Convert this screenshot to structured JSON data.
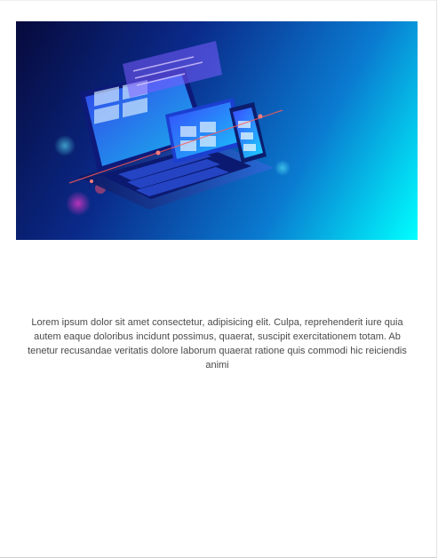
{
  "card": {
    "image_alt": "Laptop and devices with web interface illustration",
    "description": "Lorem ipsum dolor sit amet consectetur, adipisicing elit. Culpa, reprehenderit iure quia autem eaque doloribus incidunt possimus, quaerat, suscipit exercitationem totam. Ab tenetur recusandae veritatis dolore laborum quaerat ratione quis commodi hic reiciendis animi"
  },
  "colors": {
    "hero_dark": "#070a3c",
    "hero_mid": "#0a2a8a",
    "hero_light": "#00ffff",
    "text": "#4a4a4a"
  }
}
